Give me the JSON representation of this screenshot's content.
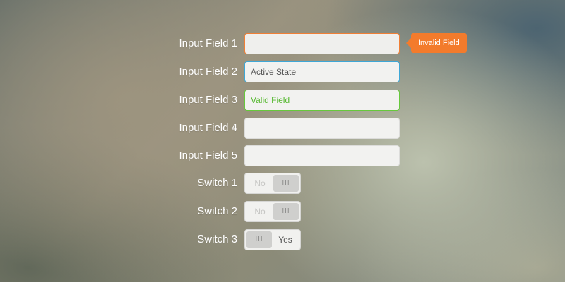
{
  "form": {
    "fields": [
      {
        "label": "Input Field 1",
        "value": "",
        "state": "invalid"
      },
      {
        "label": "Input Field 2",
        "value": "Active State",
        "state": "active"
      },
      {
        "label": "Input Field 3",
        "value": "Valid Field",
        "state": "valid"
      },
      {
        "label": "Input Field 4",
        "value": "",
        "state": "default"
      },
      {
        "label": "Input Field 5",
        "value": "",
        "state": "default"
      }
    ],
    "invalid_tooltip": "Invalid Field",
    "switches": [
      {
        "label": "Switch 1",
        "state_text": "No",
        "on": false,
        "knob_glyph": "III"
      },
      {
        "label": "Switch 2",
        "state_text": "No",
        "on": false,
        "knob_glyph": "III"
      },
      {
        "label": "Switch 3",
        "state_text": "Yes",
        "on": true,
        "knob_glyph": "III"
      }
    ]
  },
  "colors": {
    "invalid": "#f07f36",
    "active": "#3ea7d6",
    "valid": "#66c93b",
    "tooltip_bg": "#f37b2c"
  }
}
